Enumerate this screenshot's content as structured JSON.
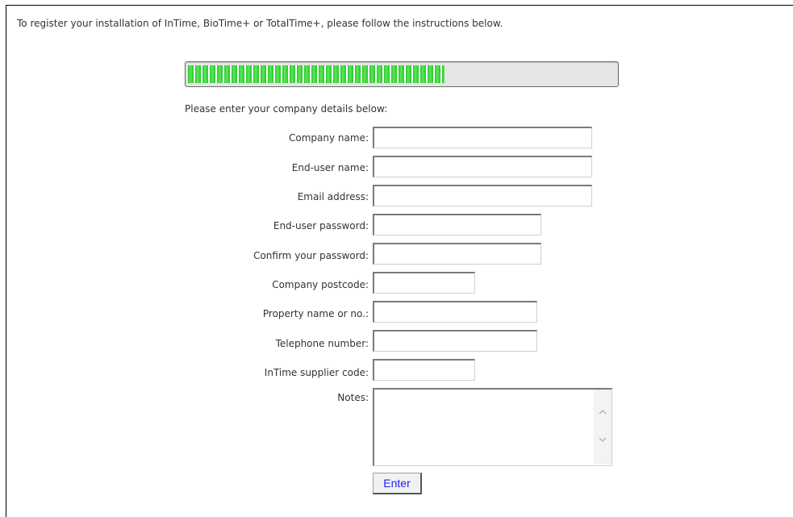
{
  "intro_text": "To register your installation of InTime, BioTime+ or TotalTime+, please follow the instructions below.",
  "progress": {
    "value_fraction": 0.6
  },
  "form": {
    "heading": "Please enter your company details below:",
    "fields": [
      {
        "label": "Company name:",
        "value": ""
      },
      {
        "label": "End-user name:",
        "value": ""
      },
      {
        "label": "Email address:",
        "value": ""
      },
      {
        "label": "End-user password:",
        "value": ""
      },
      {
        "label": "Confirm your password:",
        "value": ""
      },
      {
        "label": "Company postcode:",
        "value": ""
      },
      {
        "label": "Property name or no.:",
        "value": ""
      },
      {
        "label": "Telephone number:",
        "value": ""
      },
      {
        "label": "InTime supplier code:",
        "value": ""
      }
    ],
    "notes_label": "Notes:",
    "notes_value": "",
    "submit_label": "Enter"
  },
  "colors": {
    "progress_green": "#2ed12e",
    "button_text": "#1a1aff"
  },
  "icons": {
    "scroll_up": "chevron-up-icon",
    "scroll_down": "chevron-down-icon"
  }
}
